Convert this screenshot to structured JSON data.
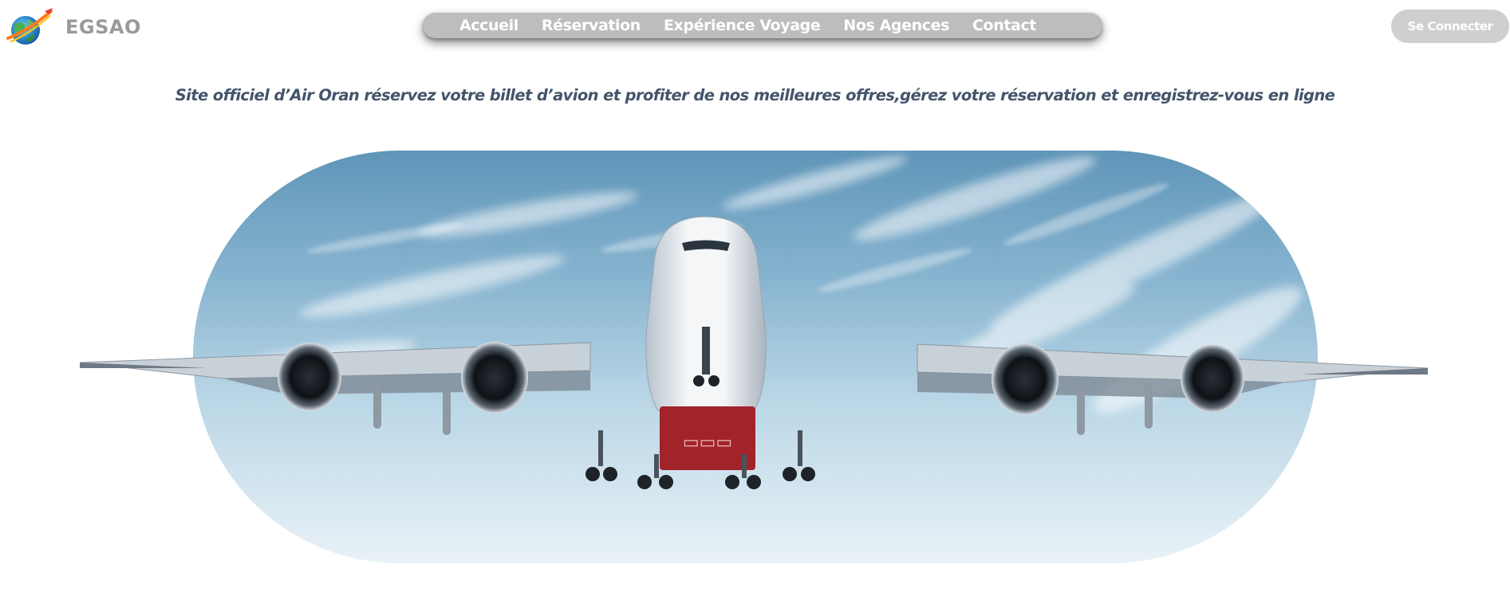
{
  "header": {
    "brand": "EGSAO",
    "logo_icon": "globe-plane-logo",
    "login_label": "Se Connecter"
  },
  "nav": {
    "items": [
      {
        "label": "Accueil"
      },
      {
        "label": "Réservation"
      },
      {
        "label": "Expérience Voyage"
      },
      {
        "label": "Nos Agences"
      },
      {
        "label": "Contact"
      }
    ]
  },
  "tagline": "Site officiel d’Air Oran réservez votre billet d’avion et profiter de nos meilleures offres,gérez votre réservation et enregistrez-vous en ligne",
  "colors": {
    "nav_bg": "#bdbdbd",
    "button_bg": "#cfcfcf",
    "tagline": "#44546b",
    "brand": "#9a9a9a"
  },
  "hero": {
    "image": "airplane-landing-photo"
  }
}
